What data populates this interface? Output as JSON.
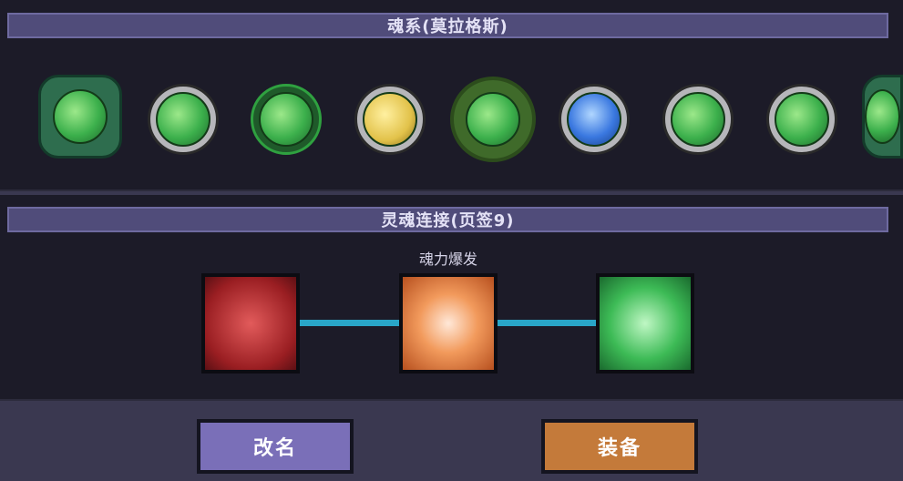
{
  "souls_panel": {
    "title": "魂系(莫拉格斯)",
    "icons": [
      {
        "name": "ornate-sword-soul-icon",
        "style": "ornate"
      },
      {
        "name": "crystal-fan-soul-icon",
        "style": "normal"
      },
      {
        "name": "green-creature-soul-icon",
        "style": "selected"
      },
      {
        "name": "golden-claw-soul-icon",
        "style": "gold"
      },
      {
        "name": "cyan-orb-soul-icon",
        "style": "wreath"
      },
      {
        "name": "purple-sword-soul-icon",
        "style": "blue"
      },
      {
        "name": "crossed-blade-soul-icon",
        "style": "normal"
      },
      {
        "name": "green-rune-soul-icon",
        "style": "normal"
      },
      {
        "name": "ornate-partial-soul-icon",
        "style": "ornate"
      }
    ]
  },
  "link_panel": {
    "title": "灵魂连接(页签9)",
    "node_label": "魂力爆发",
    "nodes": [
      {
        "name": "red-sword-skill-icon",
        "color": "#9a1e22"
      },
      {
        "name": "golden-shield-skill-icon",
        "color": "#f29a5c"
      },
      {
        "name": "stopwatch-skill-icon",
        "color": "#3dbb56"
      }
    ]
  },
  "buttons": {
    "rename": "改名",
    "equip": "装备"
  }
}
